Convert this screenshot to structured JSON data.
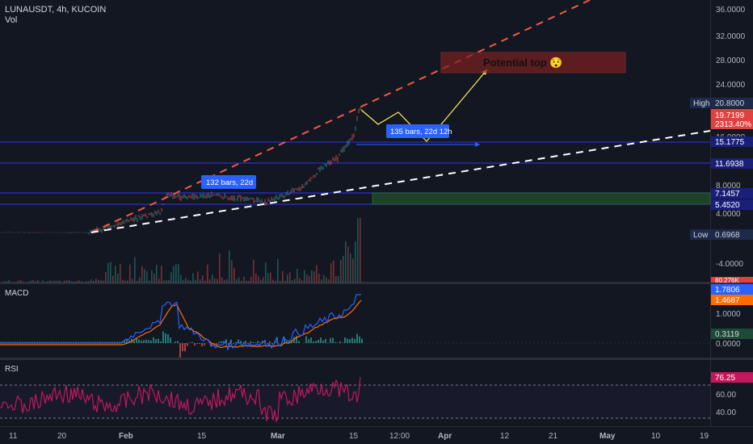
{
  "header": {
    "symbol_line": "LUNAUSDT, 4h, KUCOIN",
    "vol_label": "Vol"
  },
  "price_axis": {
    "ticks": [
      "36.0000",
      "32.0000",
      "28.0000",
      "24.0000",
      "16.0000",
      "8.0000",
      "4.0000",
      "-4.0000"
    ],
    "tags": [
      {
        "label": "High",
        "value": "20.8000",
        "kind": "label"
      },
      {
        "value": "19.7199",
        "sub": "2313.40%",
        "kind": "last"
      },
      {
        "value": "15.1775",
        "kind": "level"
      },
      {
        "value": "11.6938",
        "kind": "level"
      },
      {
        "value": "7.1457",
        "kind": "level"
      },
      {
        "value": "5.4520",
        "kind": "level"
      },
      {
        "label": "Low",
        "value": "0.6968",
        "kind": "label"
      },
      {
        "value": "80.276K",
        "kind": "vol"
      }
    ]
  },
  "macd": {
    "label": "MACD",
    "ticks": [
      "1.0000",
      "0.0000"
    ],
    "tags": [
      "1.7806",
      "1.4687",
      "0.3119"
    ]
  },
  "rsi": {
    "label": "RSI",
    "ticks": [
      "60.00",
      "40.00"
    ],
    "tag": "76.25"
  },
  "time_axis": {
    "labels": [
      "11",
      "20",
      "Feb",
      "15",
      "Mar",
      "15",
      "12:00",
      "Apr",
      "12",
      "21",
      "May",
      "10",
      "19"
    ]
  },
  "annotations": {
    "measure1": "132 bars, 22d",
    "measure2": "135 bars, 22d 12h",
    "target": "Potential top 😯"
  },
  "colors": {
    "background": "#131722",
    "up_trendline": "#f05a45",
    "support_trendline": "#ffffff",
    "horizontal_levels": "#2d2ec8",
    "projection": "#ffee58",
    "measure_label": "#2962ff",
    "macd_line": "#2962ff",
    "signal_line": "#ff6d00",
    "rsi_line": "#c2185b",
    "target_box": "#7a2020"
  }
}
